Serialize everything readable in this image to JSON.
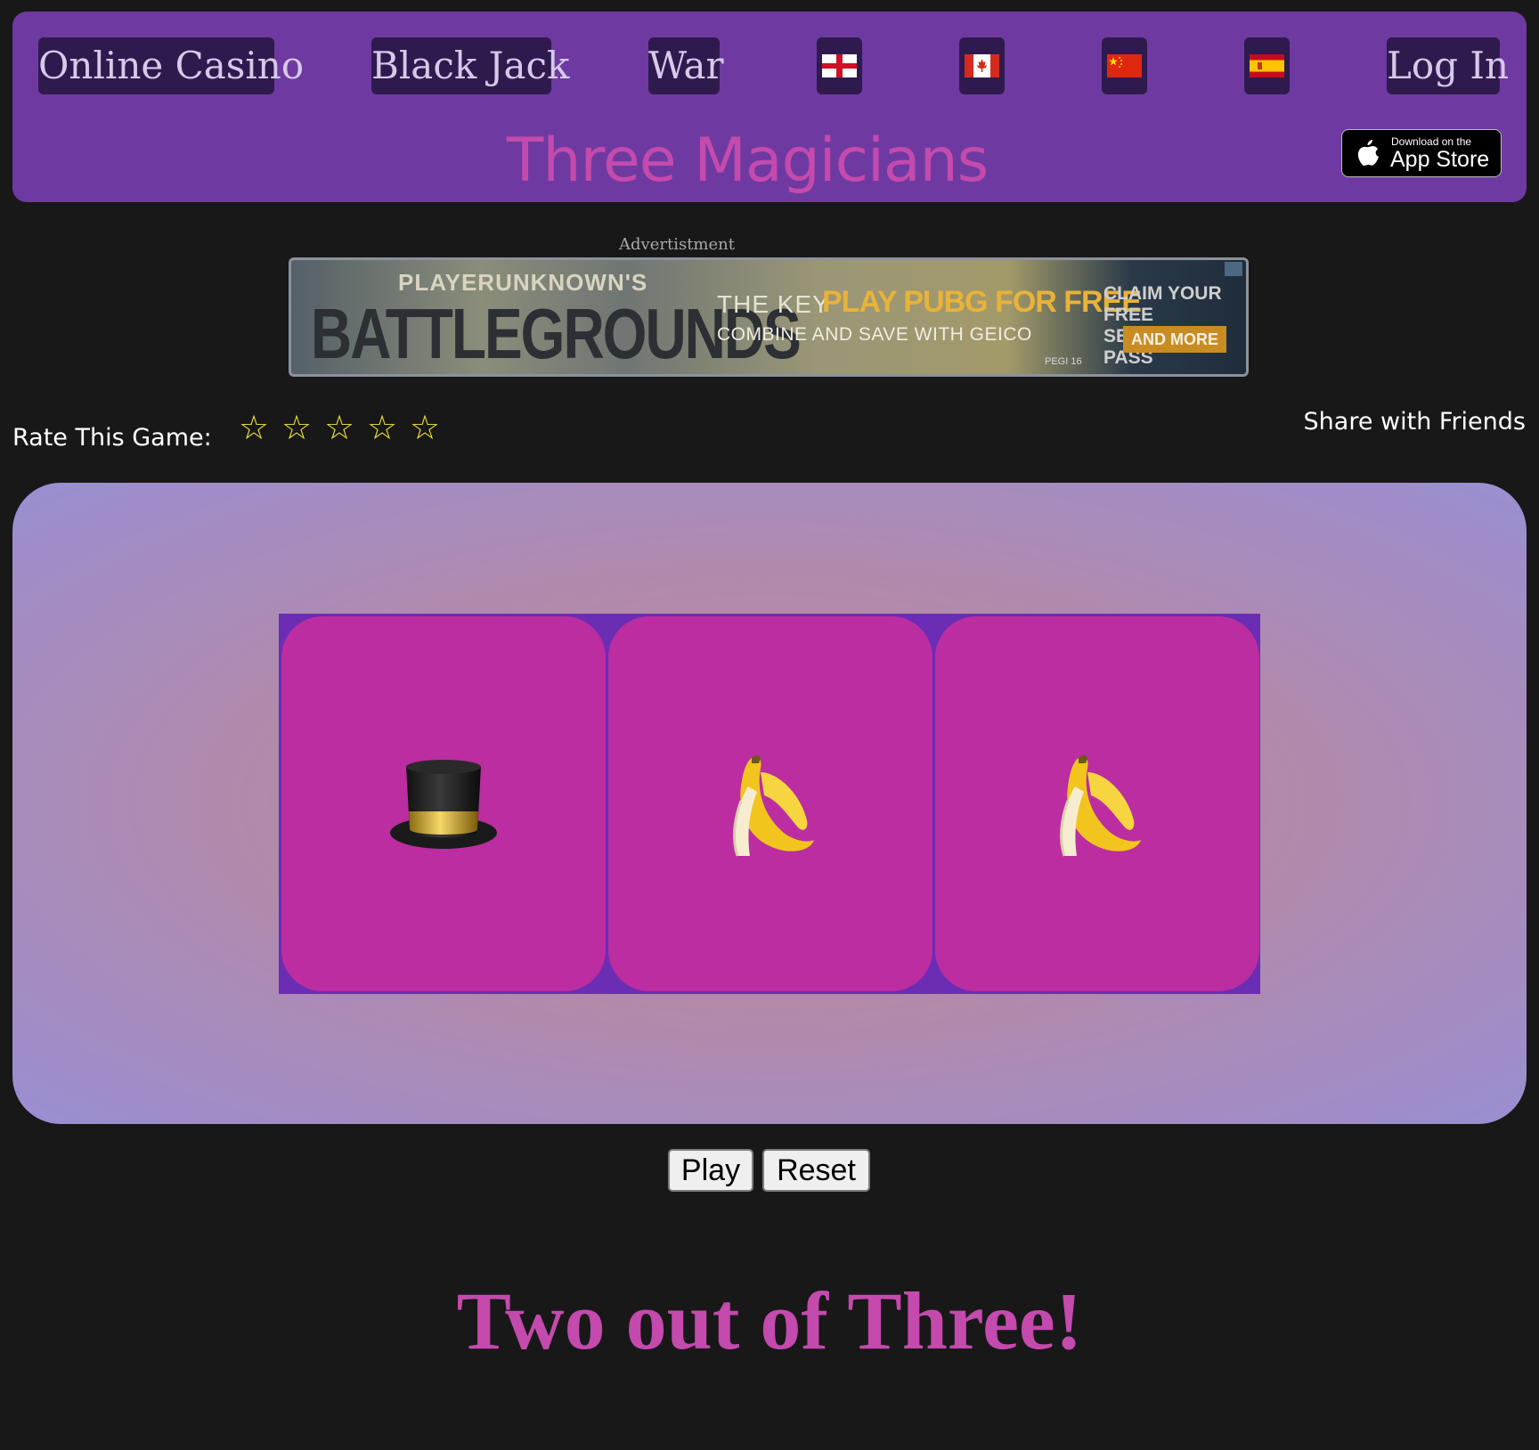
{
  "nav": {
    "online_casino": "Online Casino",
    "black_jack": "Black Jack",
    "war": "War",
    "log_in": "Log In",
    "flags": [
      "england-flag-icon",
      "canada-flag-icon",
      "china-flag-icon",
      "spain-flag-icon"
    ]
  },
  "header": {
    "title": "Three Magicians",
    "appstore_small": "Download on the",
    "appstore_big": "App Store"
  },
  "ad": {
    "label": "Advertistment",
    "pubg_line1": "PLAYERUNKNOWN'S",
    "pubg_line2": "BATTLEGROUNDS",
    "key_text": "THE KEY",
    "play_text": "PLAY PUBG FOR FREE",
    "combine_text": "COMBINE AND SAVE WITH GEICO",
    "pegi": "PEGI 16",
    "claim_text": "CLAIM YOUR FREE SEASON PASS",
    "more_text": "AND MORE"
  },
  "rating": {
    "label": "Rate This Game:",
    "stars": [
      "☆",
      "☆",
      "☆",
      "☆",
      "☆"
    ],
    "value": 0,
    "max": 5
  },
  "share": {
    "label": "Share with Friends"
  },
  "reels": [
    "top-hat",
    "banana",
    "banana"
  ],
  "controls": {
    "play": "Play",
    "reset": "Reset"
  },
  "result": "Two out of Three!",
  "colors": {
    "background": "#181818",
    "header": "#6e3aa1",
    "nav_button": "#2f1a4e",
    "title": "#c44aad",
    "reel": "#bc2da1",
    "reel_frame": "#6a2db4",
    "star": "#f2e63a"
  }
}
